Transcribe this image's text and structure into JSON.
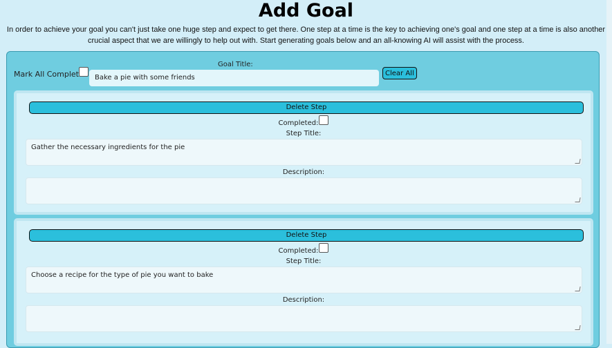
{
  "header": {
    "title": "Add Goal",
    "intro": "In order to achieve your goal you can't just take one huge step and expect to get there. One step at a time is the key to achieving one's goal and one step at a time is also another crucial aspect that we are willingly to help out with. Start generating goals below and an all-knowing AI will assist with the process."
  },
  "goal": {
    "mark_all_label": "Mark All Completed:",
    "title_label": "Goal Title:",
    "title_value": "Bake a pie with some friends",
    "clear_all_label": "Clear All"
  },
  "steps": [
    {
      "delete_label": "Delete Step",
      "completed_label": "Completed:",
      "title_label": "Step Title:",
      "title_value": "Gather the necessary ingredients for the pie",
      "description_label": "Description:",
      "description_value": ""
    },
    {
      "delete_label": "Delete Step",
      "completed_label": "Completed:",
      "title_label": "Step Title:",
      "title_value": "Choose a recipe for the type of pie you want to bake",
      "description_label": "Description:",
      "description_value": ""
    }
  ],
  "colors": {
    "background": "#d3eef8",
    "panel": "#6fcde0",
    "button": "#2bbfdc",
    "card": "#d6f1f9"
  }
}
